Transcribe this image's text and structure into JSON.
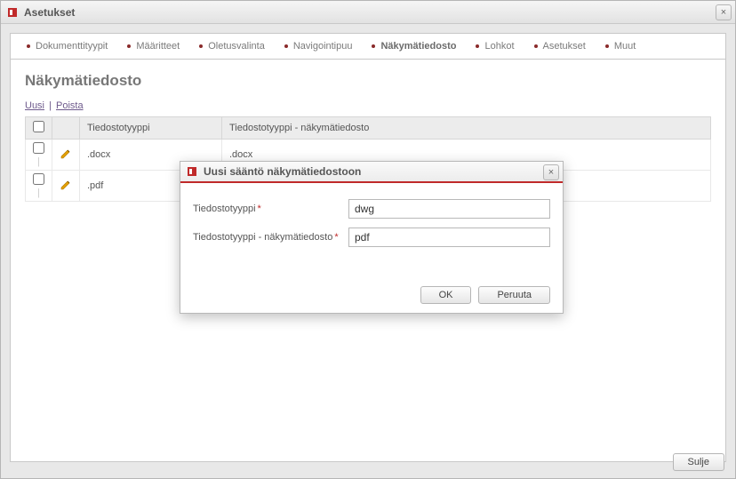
{
  "window": {
    "title": "Asetukset"
  },
  "tabs": [
    {
      "label": "Dokumenttityypit",
      "active": false
    },
    {
      "label": "Määritteet",
      "active": false
    },
    {
      "label": "Oletusvalinta",
      "active": false
    },
    {
      "label": "Navigointipuu",
      "active": false
    },
    {
      "label": "Näkymätiedosto",
      "active": true
    },
    {
      "label": "Lohkot",
      "active": false
    },
    {
      "label": "Asetukset",
      "active": false
    },
    {
      "label": "Muut",
      "active": false
    }
  ],
  "section": {
    "title": "Näkymätiedosto"
  },
  "actions": {
    "new": "Uusi",
    "delete": "Poista"
  },
  "table": {
    "headers": {
      "col_type": "Tiedostotyyppi",
      "col_view": "Tiedostotyyppi - näkymätiedosto"
    },
    "rows": [
      {
        "type": ".docx",
        "view": ".docx"
      },
      {
        "type": ".pdf",
        "view": ""
      }
    ]
  },
  "footer": {
    "close": "Sulje"
  },
  "modal": {
    "title": "Uusi sääntö näkymätiedostoon",
    "fields": {
      "type_label": "Tiedostotyyppi",
      "type_value": "dwg",
      "view_label": "Tiedostotyyppi - näkymätiedosto",
      "view_value": "pdf"
    },
    "buttons": {
      "ok": "OK",
      "cancel": "Peruuta"
    }
  }
}
